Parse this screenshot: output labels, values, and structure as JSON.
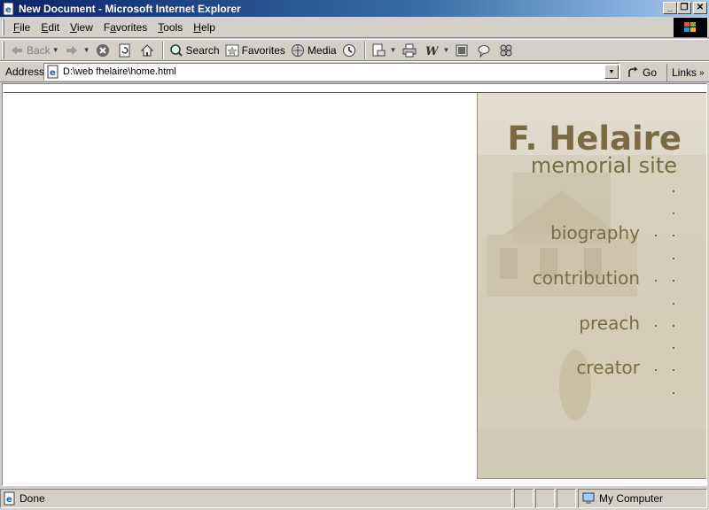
{
  "window": {
    "title": "New Document - Microsoft Internet Explorer"
  },
  "menubar": {
    "items": [
      {
        "label": "File",
        "key": "F"
      },
      {
        "label": "Edit",
        "key": "E"
      },
      {
        "label": "View",
        "key": "V"
      },
      {
        "label": "Favorites",
        "key": "a"
      },
      {
        "label": "Tools",
        "key": "T"
      },
      {
        "label": "Help",
        "key": "H"
      }
    ]
  },
  "toolbar": {
    "back_label": "Back",
    "search_label": "Search",
    "favorites_label": "Favorites",
    "media_label": "Media"
  },
  "address": {
    "label": "Address",
    "url": "D:\\web fhelaire\\home.html",
    "go_label": "Go",
    "links_label": "Links"
  },
  "page": {
    "title": "F. Helaire",
    "subtitle": "memorial site",
    "nav": [
      "biography",
      "contribution",
      "preach",
      "creator"
    ]
  },
  "status": {
    "text": "Done",
    "zone": "My Computer"
  }
}
